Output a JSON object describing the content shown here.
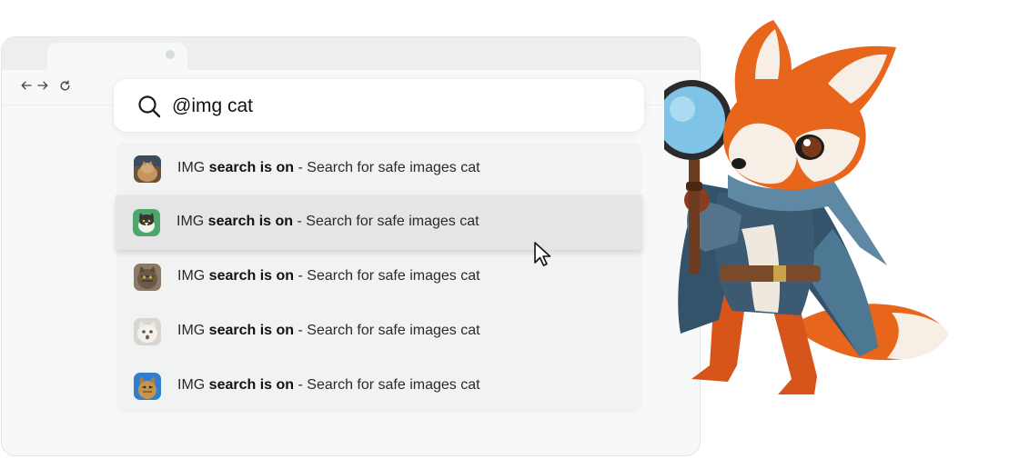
{
  "search": {
    "query": "@img cat",
    "icon": "search-icon"
  },
  "browser": {
    "nav": [
      "back-arrow-icon",
      "forward-arrow-icon",
      "reload-icon"
    ]
  },
  "suggestions": [
    {
      "prefix": "IMG ",
      "bold": "search is on",
      "rest": " - Search for safe images cat",
      "thumb": "cat-photo-1"
    },
    {
      "prefix": "IMG ",
      "bold": "search is on",
      "rest": " - Search for safe images cat",
      "thumb": "cat-photo-2"
    },
    {
      "prefix": "IMG ",
      "bold": "search is on",
      "rest": " - Search for safe images cat",
      "thumb": "cat-photo-3"
    },
    {
      "prefix": "IMG ",
      "bold": "search is on",
      "rest": " - Search for safe images cat",
      "thumb": "cat-photo-4"
    },
    {
      "prefix": "IMG ",
      "bold": "search is on",
      "rest": " - Search for safe images cat",
      "thumb": "cat-photo-5"
    }
  ],
  "colors": {
    "frame": "#f7f8f8",
    "tabbar": "#eceeef",
    "list_bg": "#f1f2f2",
    "hover_row": "#e5e5e5",
    "fox_orange": "#e8651c"
  }
}
